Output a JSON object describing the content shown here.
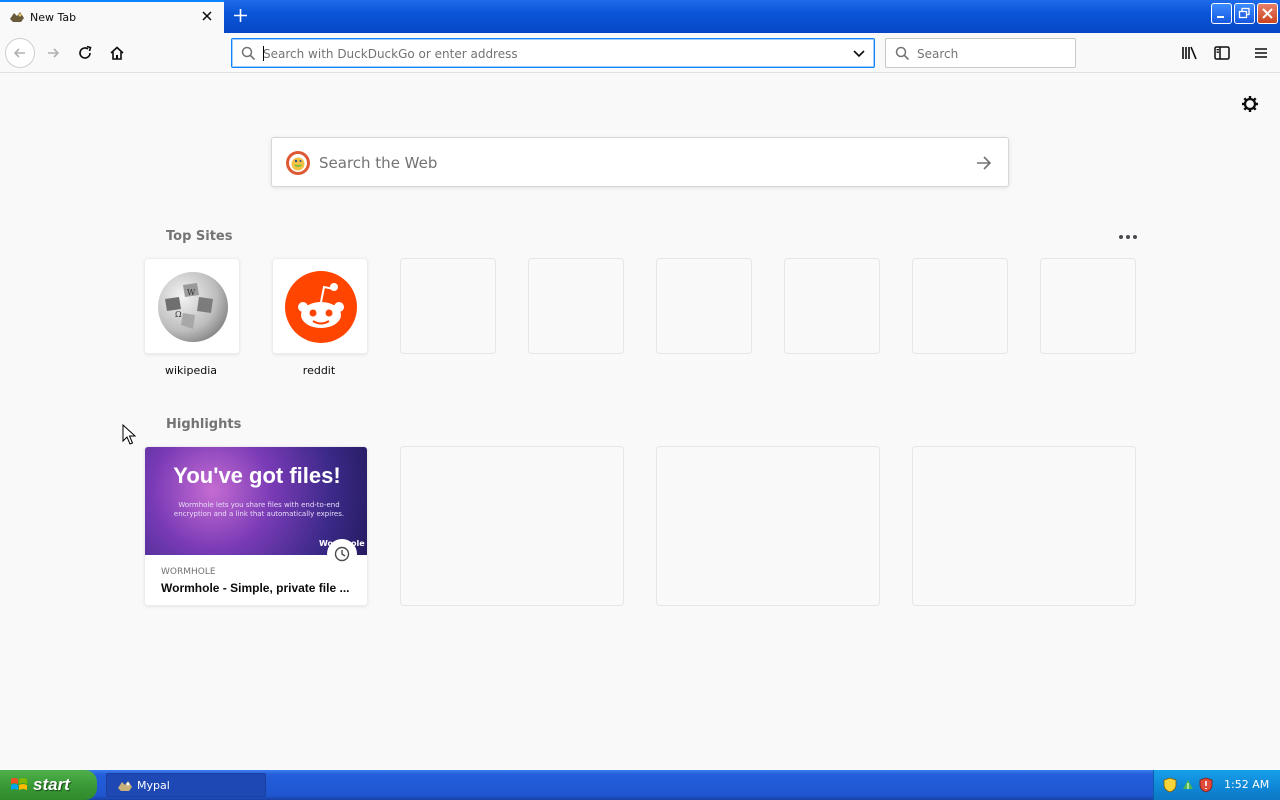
{
  "browser": {
    "tab": {
      "title": "New Tab"
    },
    "url_placeholder": "Search with DuckDuckGo or enter address",
    "search_placeholder": "Search"
  },
  "newtab": {
    "search_placeholder": "Search the Web",
    "top_sites_title": "Top Sites",
    "top_sites": [
      {
        "label": "wikipedia"
      },
      {
        "label": "reddit"
      }
    ],
    "highlights_title": "Highlights",
    "highlight": {
      "host": "WORMHOLE",
      "title": "Wormhole - Simple, private file ...",
      "preview_heading": "You've got files!",
      "preview_sub": "Wormhole lets you share files with end-to-end encryption and a link that automatically expires.",
      "preview_brand": "Wormhole"
    }
  },
  "taskbar": {
    "start_label": "start",
    "task_label": "Mypal",
    "clock": "1:52 AM"
  },
  "colors": {
    "accent": "#0a84ff",
    "reddit": "#ff4500",
    "xp_blue": "#245edb",
    "xp_green": "#3a9a37"
  }
}
